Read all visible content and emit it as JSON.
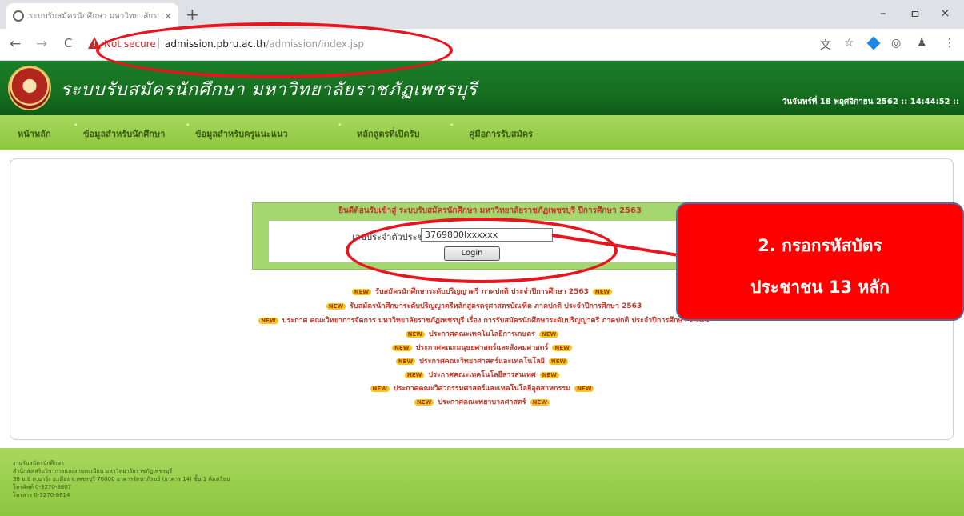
{
  "browser": {
    "tab_title": "ระบบรับสมัครนักศึกษา มหาวิทยาลัยราชภัฏ",
    "tab_close": "×",
    "new_tab": "+",
    "controls": {
      "minimize": "–",
      "maximize": "ㅁ",
      "close": "×"
    },
    "back": "←",
    "forward": "→",
    "reload": "C",
    "not_secure": "Not secure",
    "url_host": "admission.pbru.ac.th",
    "url_path": "/admission/index.jsp",
    "icons": [
      "translate-icon",
      "star-icon",
      "extension-icon",
      "camera-icon",
      "profile-icon",
      "menu-icon"
    ]
  },
  "header": {
    "title": "ระบบรับสมัครนักศึกษา  มหาวิทยาลัยราชภัฏเพชรบุรี",
    "datetime": "วันจันทร์ที่ 18 พฤศจิกายน 2562 :: 14:44:52 ::"
  },
  "menu": {
    "items": [
      {
        "label": "หน้าหลัก"
      },
      {
        "label": "ข้อมูลสำหรับนักศึกษา"
      },
      {
        "label": "ข้อมูลสำหรับครูแนะแนว"
      },
      {
        "label": "หลักสูตรที่เปิดรับ"
      },
      {
        "label": "คู่มือการรับสมัคร"
      }
    ]
  },
  "login": {
    "heading": "ยินดีต้อนรับเข้าสู่ ระบบรับสมัครนักศึกษา มหาวิทยาลัยราชภัฏเพชรบุรี ปีการศึกษา 2563",
    "id_label": "เลขประจำตัวประชาชน :",
    "id_value": "3769800Ixxxxxx",
    "button": "Login"
  },
  "announcements": {
    "new_badge": "NEW",
    "items": [
      "รับสมัครนักศึกษาระดับปริญญาตรี ภาคปกติ ประจำปีการศึกษา 2563",
      "รับสมัครนักศึกษาระดับปริญญาตรีหลักสูตรครุศาสตรบัณฑิต ภาคปกติ ประจำปีการศึกษา 2563",
      "ประกาศ คณะวิทยาการจัดการ มหาวิทยาลัยราชภัฏเพชรบุรี เรื่อง การรับสมัครนักศึกษาระดับปริญญาตรี ภาคปกติ ประจำปีการศึกษา 2563",
      "ประกาศคณะเทคโนโลยีการเกษตร",
      "ประกาศคณะมนุษยศาสตร์และสังคมศาสตร์",
      "ประกาศคณะวิทยาศาสตร์และเทคโนโลยี",
      "ประกาศคณะเทคโนโลยีสารสนเทศ",
      "ประกาศคณะวิศวกรรมศาสตร์และเทคโนโลยีอุตสาหกรรม",
      "ประกาศคณะพยาบาลศาสตร์"
    ]
  },
  "footer": {
    "lines": [
      "งานรับสมัครนักศึกษา",
      "สำนักส่งเสริมวิชาการและงานทะเบียน มหาวิทยาลัยราชภัฏเพชรบุรี",
      "38 ม.8 ต.นาวุ้ง อ.เมือง จ.เพชรบุรี 76000 อาคารรัตนาภิรมย์ (อาคาร 14) ชั้น 1 ห้องเรียน",
      "โทรศัพท์ 0-3270-8607",
      "โทรสาร 0-3270-8614"
    ]
  },
  "callout": {
    "line1": "2. กรอกรหัสบัตร",
    "line2": "ประชาชน 13 หลัก",
    "color": "#ff0000"
  }
}
